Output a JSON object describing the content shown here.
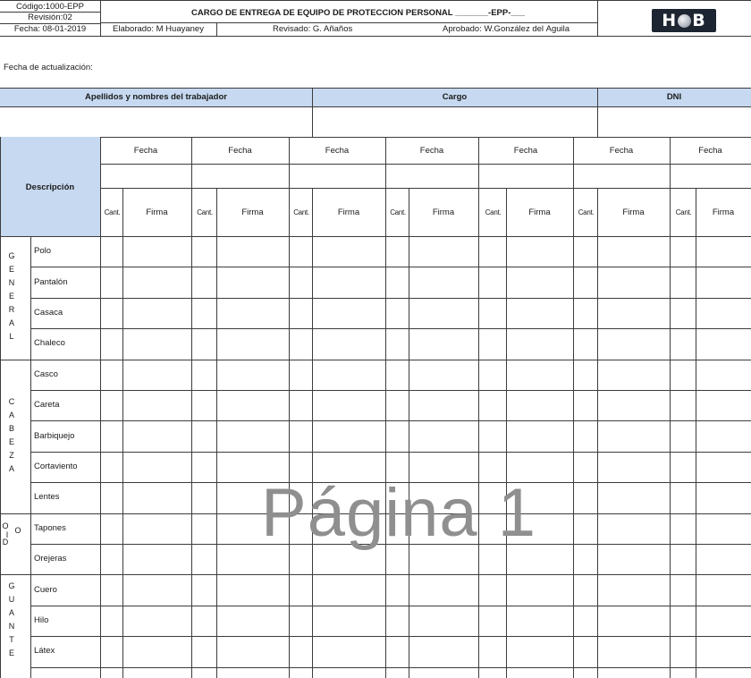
{
  "header": {
    "code": "Código:1000-EPP",
    "revision": "Revisión:02",
    "date": "Fecha: 08-01-2019",
    "title": "CARGO DE ENTREGA DE EQUIPO DE PROTECCIÓN PERSONAL _______-EPP-___",
    "prepared": "Elaborado: M Huayaney",
    "reviewed": "Revisado: G. Añaños",
    "approved": "Aprobado: W.González del Águila",
    "logo_text": "HOB"
  },
  "update_label": "Fecha de actualización:",
  "worker_header": {
    "names": "Apellidos y nombres del trabajador",
    "position": "Cargo",
    "dni": "DNI"
  },
  "grid": {
    "description": "Descripción",
    "date_label": "Fecha",
    "qty_label": "Cant.",
    "signature_label": "Firma"
  },
  "groups": [
    {
      "letters": [
        "G",
        "E",
        "N",
        "E",
        "R",
        "A",
        "L"
      ],
      "items": [
        "Polo",
        "Pantalón",
        "Casaca",
        "Chaleco"
      ]
    },
    {
      "letters": [
        "C",
        "A",
        "B",
        "E",
        "Z",
        "A"
      ],
      "items": [
        "Casco",
        "Careta",
        "Barbiquejo",
        "Cortaviento",
        "Lentes"
      ]
    },
    {
      "letters": [
        "O",
        "I",
        "O",
        "D"
      ],
      "items": [
        "Tapones",
        "Orejeras"
      ]
    },
    {
      "letters": [
        "G",
        "U",
        "A",
        "N",
        "T",
        "E"
      ],
      "items": [
        "Cuero",
        "Hilo",
        "Látex"
      ]
    }
  ],
  "watermark": "Página 1"
}
